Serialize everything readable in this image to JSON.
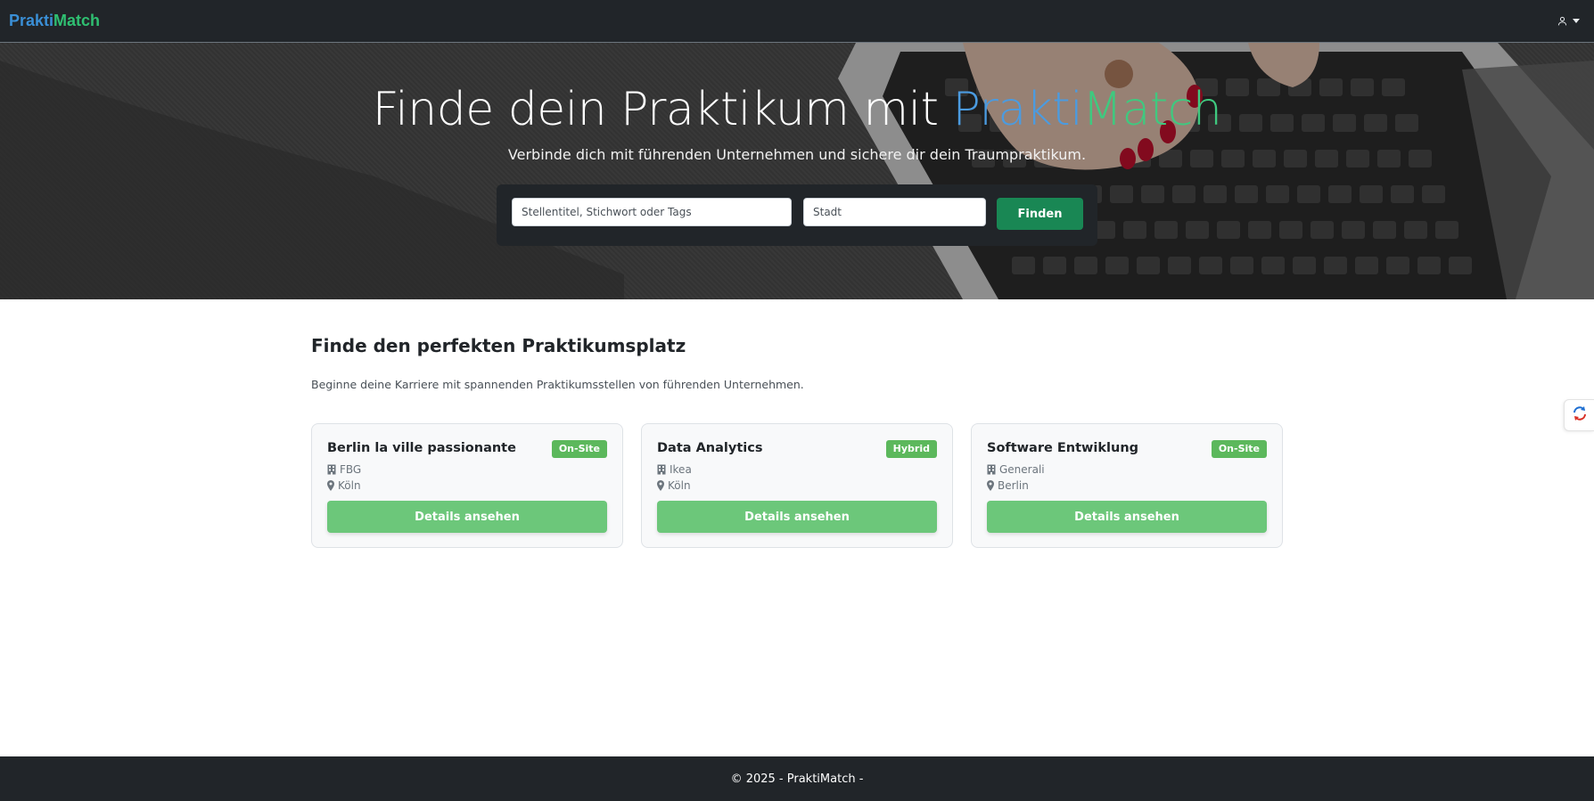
{
  "navbar": {
    "brand_part1": "Prakti",
    "brand_part2": "Match",
    "user_icon": "user-icon",
    "colors": {
      "background": "#212529",
      "brand_blue": "#3a8fd6",
      "brand_green": "#2fbf71"
    }
  },
  "hero": {
    "title_prefix": "Finde dein Praktikum mit ",
    "title_brand_part1": "Prakti",
    "title_brand_part2": "Match",
    "subtitle": "Verbinde dich mit führenden Unternehmen und sichere dir dein Traumpraktikum.",
    "search": {
      "query_placeholder": "Stellentitel, Stichwort oder Tags",
      "city_placeholder": "Stadt",
      "button_label": "Finden"
    }
  },
  "main": {
    "title": "Finde den perfekten Praktikumsplatz",
    "description": "Beginne deine Karriere mit spannenden Praktikumsstellen von führenden Unternehmen.",
    "cards": [
      {
        "title": "Berlin la ville passionante",
        "badge": "On-Site",
        "company": "FBG",
        "city": "Köln",
        "button_label": "Details ansehen"
      },
      {
        "title": "Data Analytics",
        "badge": "Hybrid",
        "company": "Ikea",
        "city": "Köln",
        "button_label": "Details ansehen"
      },
      {
        "title": "Software Entwiklung",
        "badge": "On-Site",
        "company": "Generali",
        "city": "Berlin",
        "button_label": "Details ansehen"
      }
    ]
  },
  "footer": {
    "text": "© 2025 - PraktiMatch -"
  }
}
